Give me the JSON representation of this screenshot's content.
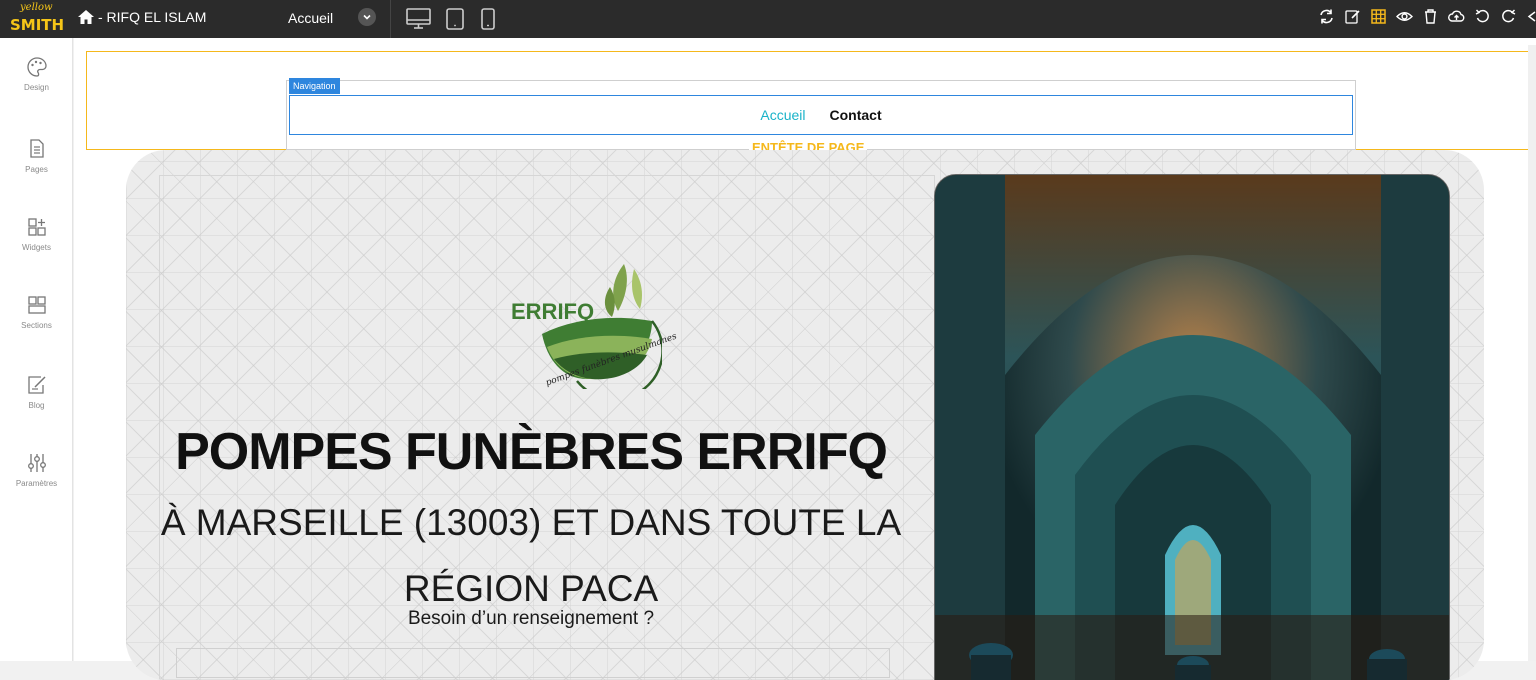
{
  "topbar": {
    "logo_script": "yellow",
    "logo_word": "SMITH",
    "site_title": "- RIFQ EL ISLAM",
    "page_selected": "Accueil",
    "devices": [
      "desktop-icon",
      "tablet-icon",
      "mobile-icon"
    ],
    "tools": [
      "sync-icon",
      "edit-icon",
      "grid-icon",
      "eye-icon",
      "trash-icon",
      "cloud-upload-icon",
      "undo-icon",
      "redo-icon",
      "code-icon"
    ],
    "accent": "#f5c518"
  },
  "sidebar": {
    "items": [
      {
        "label": "Design",
        "icon": "palette-icon"
      },
      {
        "label": "Pages",
        "icon": "pages-icon"
      },
      {
        "label": "Widgets",
        "icon": "widgets-add-icon"
      },
      {
        "label": "Sections",
        "icon": "sections-icon"
      },
      {
        "label": "Blog",
        "icon": "blog-edit-icon"
      },
      {
        "label": "Paramètres",
        "icon": "sliders-icon"
      }
    ]
  },
  "header": {
    "nav_tag": "Navigation",
    "nav_links": [
      "Accueil",
      "Contact"
    ],
    "frame_label": "ENTÊTE DE PAGE",
    "frame_color": "#f5b81b",
    "nav_active_color": "#1ab3c9"
  },
  "hero": {
    "brand_word": "ERRIFQ",
    "brand_tagline": "pompes funèbres musulmanes",
    "title": "POMPES FUNÈBRES ERRIFQ",
    "subtitle_line1": "À MARSEILLE (13003) ET DANS TOUTE LA",
    "subtitle_line2": "RÉGION PACA",
    "help_text": "Besoin d’un renseignement ?"
  }
}
